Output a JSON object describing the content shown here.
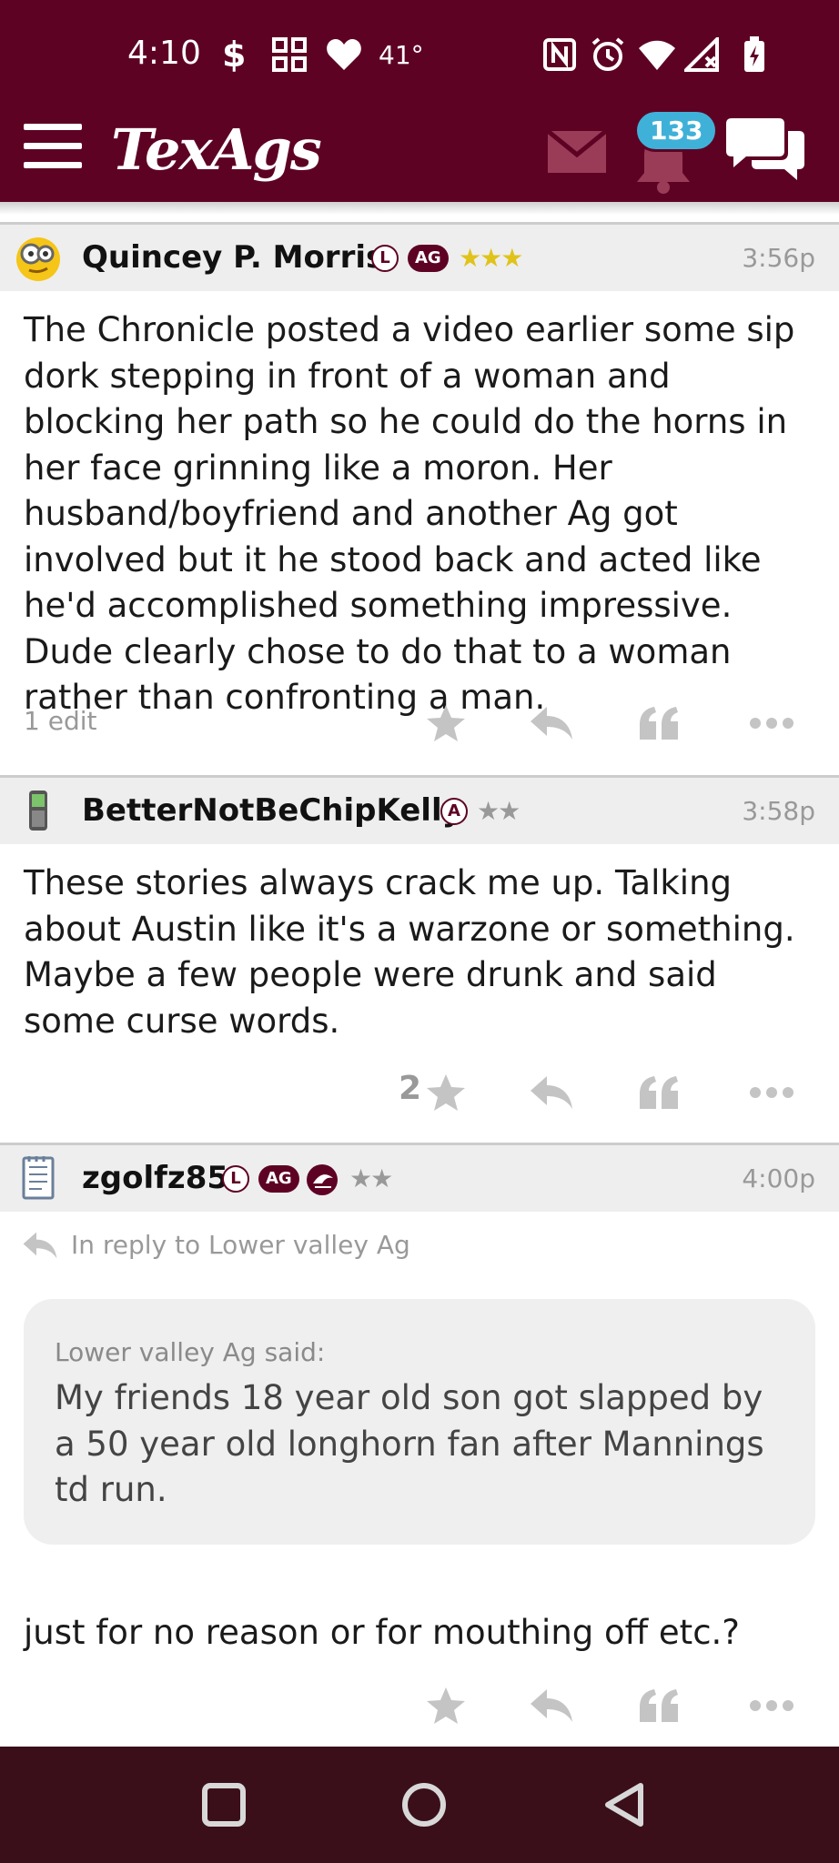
{
  "status_bar": {
    "time": "4:10",
    "temperature": "41°",
    "icons": [
      "dollar-icon",
      "grid-icon",
      "heart-icon",
      "nfc-icon",
      "alarm-icon",
      "wifi-icon",
      "signal-icon",
      "battery-icon"
    ]
  },
  "header": {
    "logo": "TexAgs",
    "notification_count": "133"
  },
  "colors": {
    "brand_maroon": "#5e0224",
    "badge_blue": "#3fb1d8",
    "nav_bar": "#3a0f1a",
    "star_gold": "#e0c31a"
  },
  "posts": [
    {
      "username": "Quincey P. Morris",
      "badges": [
        "L",
        "AG"
      ],
      "stars": "★★★",
      "time": "3:56p",
      "body": "The Chronicle posted a video earlier some sip dork stepping in front of a woman and blocking her path so he could do the horns in her face grinning like a moron. Her husband/boyfriend and another Ag got involved but it he stood back and acted like he'd accomplished something impressive. Dude clearly chose to do that to a woman rather than confronting a man.",
      "edit_note": "1 edit"
    },
    {
      "username": "BetterNotBeChipKelly",
      "badges": [
        "A"
      ],
      "stars": "★★",
      "time": "3:58p",
      "body": "These stories always crack me up. Talking about Austin like it's a warzone or something. Maybe a few people were drunk and said some curse words.",
      "star_count": "2"
    },
    {
      "username": "zgolfz85",
      "badges": [
        "L",
        "AG"
      ],
      "stars": "★★",
      "time": "4:00p",
      "reply_to": "In reply to Lower valley Ag",
      "quote_author": "Lower valley Ag said:",
      "quote_text": "My friends 18 year old son got slapped by a 50 year old longhorn fan after Mannings td run.",
      "body": "just for no reason or for mouthing off etc.?"
    }
  ]
}
